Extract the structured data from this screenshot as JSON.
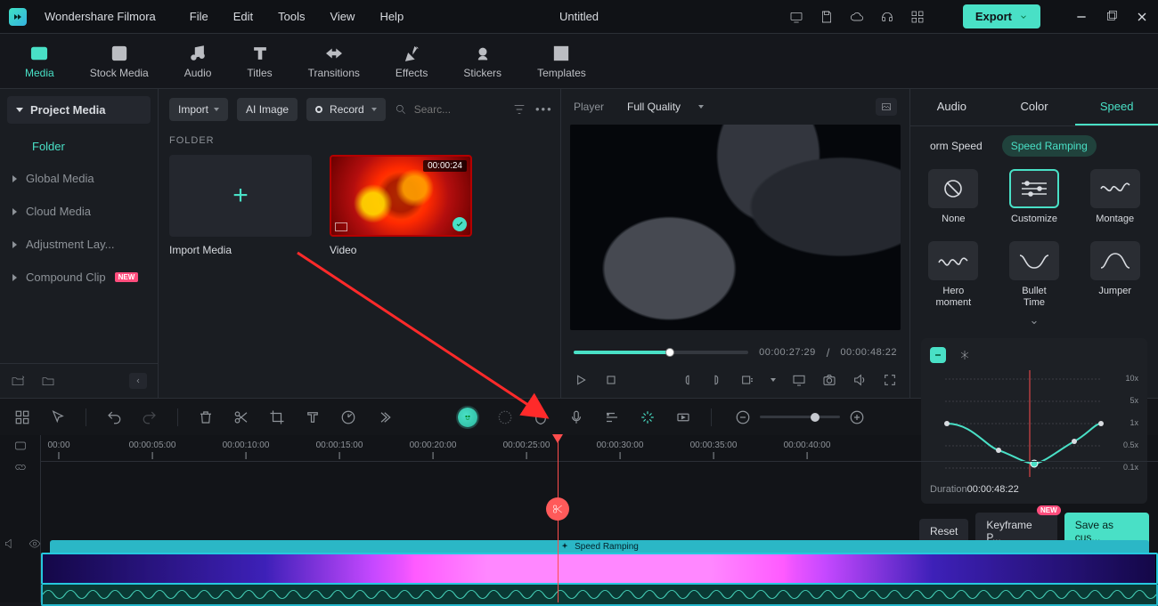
{
  "app": {
    "name": "Wondershare Filmora",
    "document": "Untitled"
  },
  "menu": {
    "file": "File",
    "edit": "Edit",
    "tools": "Tools",
    "view": "View",
    "help": "Help"
  },
  "titlebar": {
    "export": "Export"
  },
  "tabs": {
    "media": "Media",
    "stock": "Stock Media",
    "audio": "Audio",
    "titles": "Titles",
    "transitions": "Transitions",
    "effects": "Effects",
    "stickers": "Stickers",
    "templates": "Templates"
  },
  "browser": {
    "header": "Project Media",
    "folder": "Folder",
    "items": [
      "Global Media",
      "Cloud Media",
      "Adjustment Lay...",
      "Compound Clip"
    ],
    "new_badge": "NEW"
  },
  "media_toolbar": {
    "import": "Import",
    "ai_image": "AI Image",
    "record": "Record",
    "search_placeholder": "Searc..."
  },
  "folder_label": "FOLDER",
  "cards": {
    "import_media": "Import Media",
    "video": {
      "label": "Video",
      "duration": "00:00:24"
    }
  },
  "preview": {
    "player": "Player",
    "quality": "Full Quality",
    "current": "00:00:27:29",
    "total": "00:00:48:22",
    "slash": "/"
  },
  "inspector": {
    "tabs": {
      "audio": "Audio",
      "color": "Color",
      "speed": "Speed"
    },
    "sub": {
      "uniform": "orm Speed",
      "ramping": "Speed Ramping"
    },
    "presets": {
      "none": "None",
      "customize": "Customize",
      "montage": "Montage",
      "hero": "Hero\nmoment",
      "bullet": "Bullet\nTime",
      "jumper": "Jumper"
    },
    "ylabels": [
      "10x",
      "5x",
      "1x",
      "0.5x",
      "0.1x"
    ],
    "duration_label": "Duration",
    "duration_value": "00:00:48:22",
    "reset": "Reset",
    "keyframe": "Keyframe P...",
    "save": "Save as cus...",
    "new_badge": "NEW"
  },
  "ruler": [
    "00:00",
    "00:00:05:00",
    "00:00:10:00",
    "00:00:15:00",
    "00:00:20:00",
    "00:00:25:00",
    "00:00:30:00",
    "00:00:35:00",
    "00:00:40:00"
  ],
  "speed_ramp_track": "Speed Ramping",
  "clip_name": "Video",
  "track_index": "1"
}
